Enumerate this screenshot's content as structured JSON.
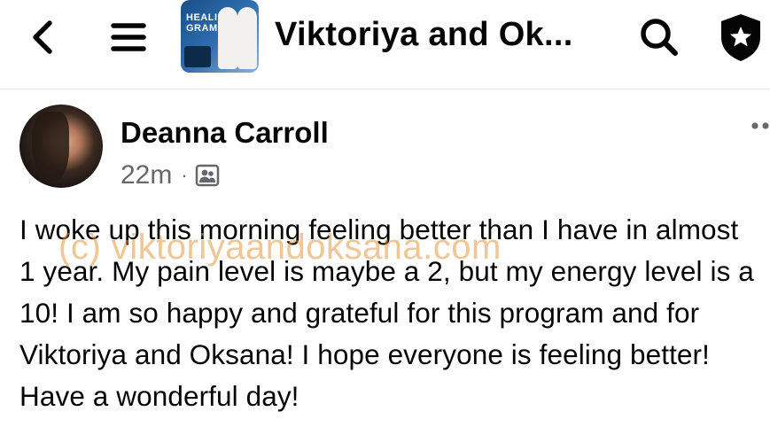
{
  "header": {
    "back_icon": "chevron-left-icon",
    "menu_icon": "hamburger-menu-icon",
    "group_title": "Viktoriya and Ok...",
    "thumbnail_text": "HEALING\nGRAM",
    "search_icon": "search-icon",
    "admin_icon": "shield-star-icon"
  },
  "post": {
    "author": "Deanna Carroll",
    "time": "22m",
    "separator": "·",
    "audience_icon": "group-members-icon",
    "more_icon": "more-options-icon",
    "body": "I woke up this morning feeling better than I have in almost 1 year. My pain level is maybe a 2, but my energy level is a 10! I am so happy and grateful for this program and for Viktoriya and Oksana! I hope everyone is feeling better! Have a wonderful day!"
  },
  "watermark": "(c) viktoriyaandoksana.com",
  "colors": {
    "text": "#050505",
    "secondary_text": "#65676b",
    "divider": "#e4e6eb",
    "watermark": "#e6963c"
  }
}
